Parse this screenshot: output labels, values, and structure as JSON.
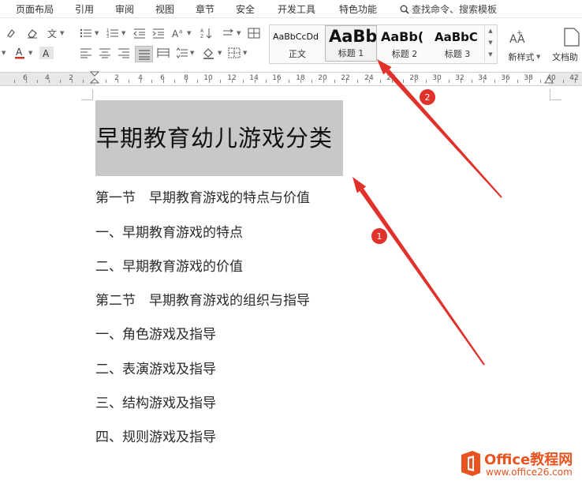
{
  "menu": {
    "items": [
      "页面布局",
      "引用",
      "审阅",
      "视图",
      "章节",
      "安全",
      "开发工具",
      "特色功能"
    ],
    "search_placeholder": "查找命令、搜索模板"
  },
  "toolbar": {
    "styles": [
      {
        "sample": "AaBbCcDd",
        "label": "正文"
      },
      {
        "sample": "AaBb",
        "label": "标题 1"
      },
      {
        "sample": "AaBb(",
        "label": "标题 2"
      },
      {
        "sample": "AaBbC",
        "label": "标题 3"
      }
    ],
    "new_style_label": "新样式",
    "new_style_icon_text": "AA",
    "doc_helper_label": "文档助"
  },
  "ruler": {
    "labels": [
      "6",
      "4",
      "2",
      "2",
      "4",
      "6",
      "8",
      "10",
      "12",
      "14",
      "16",
      "18",
      "20",
      "22",
      "24",
      "26",
      "28",
      "30",
      "32",
      "34",
      "36",
      "38",
      "40",
      "42"
    ]
  },
  "document": {
    "title": "早期教育幼儿游戏分类",
    "paragraphs": [
      "第一节　早期教育游戏的特点与价值",
      "一、早期教育游戏的特点",
      "二、早期教育游戏的价值",
      "第二节　早期教育游戏的组织与指导",
      "一、角色游戏及指导",
      "二、表演游戏及指导",
      "三、结构游戏及指导",
      "四、规则游戏及指导"
    ]
  },
  "annotations": {
    "badge_1": "1",
    "badge_2": "2",
    "arrow_color": "#e0312b"
  },
  "watermark": {
    "brand": "Office教程网",
    "url": "www.office26.com",
    "brand_color": "#e8531f"
  }
}
